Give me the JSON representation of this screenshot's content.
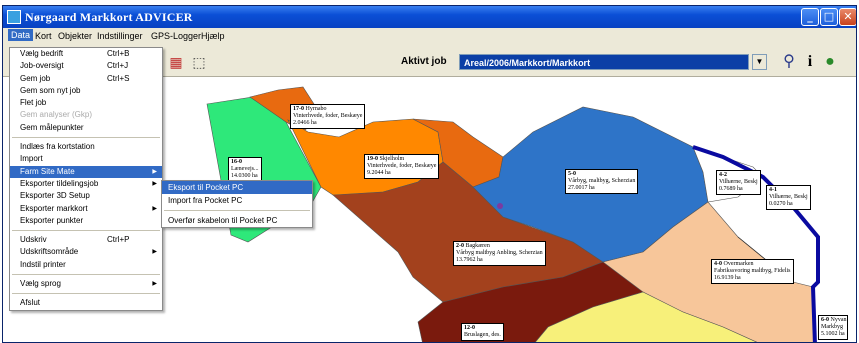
{
  "window": {
    "title": "Nørgaard Markkort ADVICER",
    "minimize": "_",
    "maximize": "□",
    "close": "✕"
  },
  "menubar": [
    "Data",
    "Kort",
    "Objekter",
    "Indstillinger",
    "GPS-Logger",
    "Hjælp"
  ],
  "toolbar": {
    "job_label": "Aktivt job",
    "job_value": "Areal/2006/Markkort/Markkort",
    "combo_arrow": "▼",
    "icons": [
      "search-icon",
      "info-icon",
      "globe-icon"
    ]
  },
  "data_menu": {
    "groups": [
      [
        {
          "label": "Vælg bedrift",
          "shortcut": "Ctrl+B"
        },
        {
          "label": "Job-oversigt",
          "shortcut": "Ctrl+J"
        },
        {
          "label": "Gem job",
          "shortcut": "Ctrl+S"
        },
        {
          "label": "Gem som nyt job",
          "shortcut": ""
        },
        {
          "label": "Flet job",
          "shortcut": ""
        },
        {
          "label": "Gem analyser (Gkp)",
          "shortcut": "",
          "disabled": true
        },
        {
          "label": "Gem målepunkter",
          "shortcut": ""
        }
      ],
      [
        {
          "label": "Indlæs fra kortstation",
          "shortcut": ""
        },
        {
          "label": "Import",
          "shortcut": ""
        },
        {
          "label": "Farm Site Mate",
          "shortcut": "",
          "submenu": true,
          "active": true
        },
        {
          "label": "Eksporter tildelingsjob",
          "shortcut": "",
          "submenu": true
        },
        {
          "label": "Eksporter 3D Setup",
          "shortcut": ""
        },
        {
          "label": "Eksporter markkort",
          "shortcut": "",
          "submenu": true
        },
        {
          "label": "Eksporter punkter",
          "shortcut": ""
        }
      ],
      [
        {
          "label": "Udskriv",
          "shortcut": "Ctrl+P"
        },
        {
          "label": "Udskriftsområde",
          "shortcut": "",
          "submenu": true
        },
        {
          "label": "Indstil printer",
          "shortcut": ""
        }
      ],
      [
        {
          "label": "Vælg sprog",
          "shortcut": "",
          "submenu": true
        }
      ],
      [
        {
          "label": "Afslut",
          "shortcut": ""
        }
      ]
    ],
    "submenu_arrow": "▶"
  },
  "farm_site_submenu": [
    {
      "label": "Eksport til Pocket PC",
      "active": true
    },
    {
      "label": "Import fra Pocket PC"
    },
    {
      "label": "Overfør skabelon til Pocket PC"
    }
  ],
  "field_labels": [
    {
      "id": "17-0",
      "name": "Hyrnabo",
      "crop": "Vinterhvede, foder, Beskæye",
      "area": "2.0466 ha"
    },
    {
      "id": "16-0",
      "name": "Lænevejs...",
      "crop": "",
      "area": "14.0300 ha"
    },
    {
      "id": "19-0",
      "name": "Skjelholm",
      "crop": "Vinterhvede, foder, Beskæye",
      "area": "9.2044 ha"
    },
    {
      "id": "5-0",
      "name": "",
      "crop": "Vårbyg, maltbyg, Scherzian",
      "area": "27.0017 ha"
    },
    {
      "id": "4-2",
      "name": "Vilhærne, Beskj",
      "crop": "",
      "area": "0.7689 ha"
    },
    {
      "id": "4-1",
      "name": "",
      "crop": "Vilhærne, Beskj",
      "area": "0.0270 ha"
    },
    {
      "id": "2-0",
      "name": "Bagkæren",
      "crop": "Vårbyg maltbyg Anbling, Scherzian",
      "area": "13.7962 ha"
    },
    {
      "id": "4-0",
      "name": "Overmarken",
      "crop": "Fabrikssvoring maltbyg, Fidelis",
      "area": "16.9139 ha"
    },
    {
      "id": "12-0",
      "name": "Bruslagen, des.",
      "crop": "",
      "area": ""
    },
    {
      "id": "6-0",
      "name": "Nyvan",
      "crop": "Markbyg",
      "area": "5.1002 ha"
    }
  ],
  "colors": {
    "titlebar": "#0b4fd6",
    "highlight": "#316ac5",
    "field_green": "#2ee87a",
    "field_orange": "#ff8800",
    "field_darkorange": "#e86a10",
    "field_brown": "#a3411d",
    "field_darkbrown": "#7a1a0d",
    "field_blue": "#2e74c8",
    "field_peach": "#f7c69a",
    "field_yellow": "#f7f07a",
    "boundary": "#0a0aa0"
  }
}
